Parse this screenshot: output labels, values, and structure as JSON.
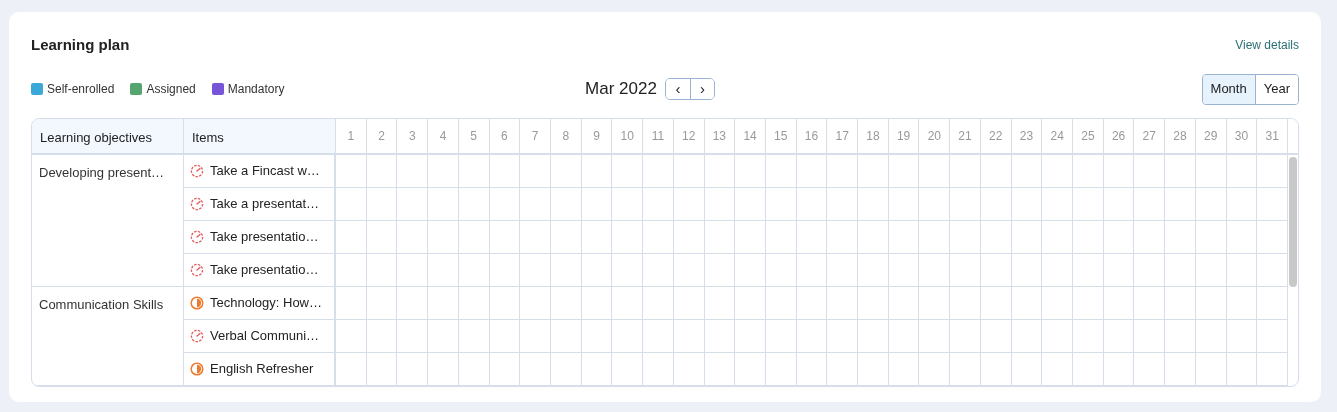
{
  "card": {
    "title": "Learning plan",
    "link": "View details"
  },
  "legend": [
    {
      "label": "Self-enrolled",
      "color": "#3aa9d8"
    },
    {
      "label": "Assigned",
      "color": "#55a56f"
    },
    {
      "label": "Mandatory",
      "color": "#7655d6"
    }
  ],
  "calendar": {
    "month": "Mar 2022",
    "prev": "‹",
    "next": "›"
  },
  "views": [
    {
      "label": "Month",
      "selected": true
    },
    {
      "label": "Year",
      "selected": false
    }
  ],
  "table": {
    "columns": [
      "Learning objectives",
      "Items"
    ],
    "days": [
      "1",
      "2",
      "3",
      "4",
      "5",
      "6",
      "7",
      "8",
      "9",
      "10",
      "11",
      "12",
      "13",
      "14",
      "15",
      "16",
      "17",
      "18",
      "19",
      "20",
      "21",
      "22",
      "23",
      "24",
      "25",
      "26",
      "27",
      "28",
      "29",
      "30",
      "31"
    ],
    "objectives": [
      {
        "name": "Developing present…",
        "items": [
          {
            "title": "Take a Fincast w…",
            "kind": "gauge"
          },
          {
            "title": "Take a presentat…",
            "kind": "gauge"
          },
          {
            "title": "Take presentatio…",
            "kind": "gauge"
          },
          {
            "title": "Take presentatio…",
            "kind": "gauge"
          }
        ]
      },
      {
        "name": "Communication Skills",
        "items": [
          {
            "title": "Technology: How…",
            "kind": "pie"
          },
          {
            "title": "Verbal Communi…",
            "kind": "gauge"
          },
          {
            "title": "English Refresher",
            "kind": "pie"
          }
        ]
      }
    ]
  }
}
